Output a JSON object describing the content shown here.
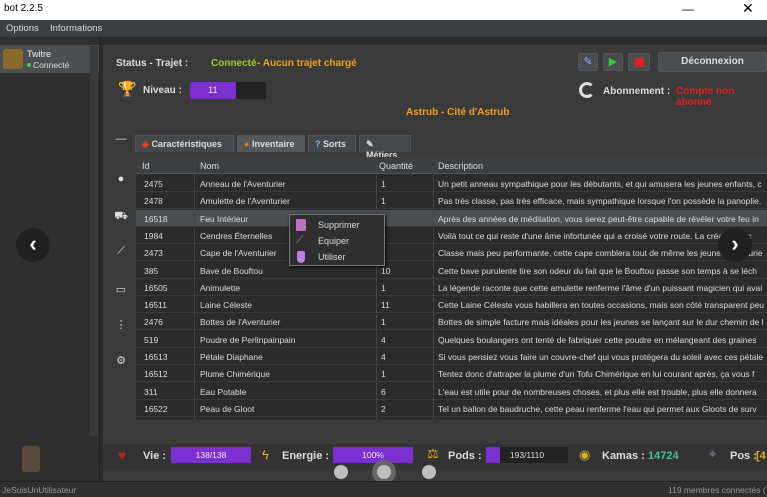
{
  "window": {
    "title": "bot 2.2.5",
    "minimize": "—",
    "close": "✕"
  },
  "menu": {
    "items": [
      "Options",
      "Informations"
    ]
  },
  "account": {
    "name": "Twitre",
    "status": "Connecté"
  },
  "header": {
    "status_label": "Status - Trajet :",
    "status_value": "Connecté",
    "route_value": "-  Aucun trajet chargé",
    "level_label": "Niveau :",
    "level_value": "11",
    "level_progress": 0.6,
    "location": "Astrub - Cité d'Astrub",
    "subscription_label": "Abonnement :",
    "subscription_value": "Compte non abonné",
    "disconnect_label": "Déconnexion"
  },
  "tabs": [
    {
      "label": "Caractéristiques",
      "icon": "shield-icon"
    },
    {
      "label": "Inventaire",
      "icon": "bag-icon"
    },
    {
      "label": "Sorts",
      "icon": "question-icon"
    },
    {
      "label": "Métiers",
      "icon": "pencil-icon"
    }
  ],
  "table": {
    "columns": [
      "Id",
      "Nom",
      "Quantité",
      "Description"
    ],
    "rows": [
      {
        "id": "2475",
        "name": "Anneau de l'Aventurier",
        "qty": "1",
        "desc": "Un petit anneau sympathique pour les débutants, et qui amusera les jeunes enfants, c"
      },
      {
        "id": "2478",
        "name": "Amulette de l'Aventurier",
        "qty": "1",
        "desc": "Pas très classe, pas très efficace, mais sympathique lorsque l'on possède la panoplie."
      },
      {
        "id": "16518",
        "name": "Feu Intérieur",
        "qty": "",
        "desc": "Après des années de méditation, vous serez peut-être capable de révéler votre feu in"
      },
      {
        "id": "1984",
        "name": "Cendres Éternelles",
        "qty": "9",
        "desc": "Voilà tout ce qui reste d'une âme infortunée qui a croisé votre route. La créature a c"
      },
      {
        "id": "2473",
        "name": "Cape de l'Aventurier",
        "qty": "",
        "desc": "Classe mais peu performante, cette cape comblera tout de même les jeunes aventurie"
      },
      {
        "id": "385",
        "name": "Bave de Bouftou",
        "qty": "10",
        "desc": "Cette bave purulente tire son odeur du fait que le Bouftou passe son temps à se léch"
      },
      {
        "id": "16505",
        "name": "Animulette",
        "qty": "1",
        "desc": "La légende raconte que cette amulette renferme l'âme d'un puissant magicien qui avai"
      },
      {
        "id": "16511",
        "name": "Laine Céleste",
        "qty": "11",
        "desc": "Cette Laine Céleste vous habillera en toutes occasions, mais son côté transparent peu"
      },
      {
        "id": "2476",
        "name": "Bottes de l'Aventurier",
        "qty": "1",
        "desc": "Bottes de simple facture mais idéales pour les jeunes se lançant sur le dur chemin de l"
      },
      {
        "id": "519",
        "name": "Poudre de Perlinpainpain",
        "qty": "4",
        "desc": "Quelques boulangers ont tenté de fabriquer cette poudre en mélangeant des graines"
      },
      {
        "id": "16513",
        "name": "Pétale Diaphane",
        "qty": "4",
        "desc": "Si vous pensiez vous faire un couvre-chef qui vous protégera du soleil avec ces pétale"
      },
      {
        "id": "16512",
        "name": "Plume Chimérique",
        "qty": "1",
        "desc": "Tentez donc d'attraper la plume d'un Tofu Chimérique en lui courant après, ça vous f"
      },
      {
        "id": "311",
        "name": "Eau Potable",
        "qty": "6",
        "desc": "L'eau est utile pour de nombreuses choses, et plus elle est trouble, plus elle donnera"
      },
      {
        "id": "16522",
        "name": "Peau de Gloot",
        "qty": "2",
        "desc": "Tel un ballon de baudruche, cette peau renferme l'eau qui permet aux Gloots de surv"
      }
    ]
  },
  "context_menu": [
    {
      "label": "Supprimer",
      "icon": "trash-icon",
      "color": "#c070c0"
    },
    {
      "label": "Equiper",
      "icon": "sword-icon",
      "color": "#8080c0"
    },
    {
      "label": "Utiliser",
      "icon": "potion-icon",
      "color": "#c080e0"
    }
  ],
  "stats": {
    "vie_label": "Vie :",
    "vie_value": "138/138",
    "vie_fill": 1.0,
    "energie_label": "Energie :",
    "energie_value": "100%",
    "energie_fill": 1.0,
    "pods_label": "Pods :",
    "pods_value": "193/1110",
    "pods_fill": 0.17,
    "kamas_label": "Kamas :",
    "kamas_value": "14724",
    "pos_label": "Pos :",
    "pos_value": "[4"
  },
  "statusbar": {
    "user": "JeSuisUnUtilisateur",
    "members": "119 membres connectés ("
  },
  "colors": {
    "accent": "#7b2fd0",
    "green": "#9acd32",
    "orange": "#f0a020",
    "red": "#e02020"
  }
}
